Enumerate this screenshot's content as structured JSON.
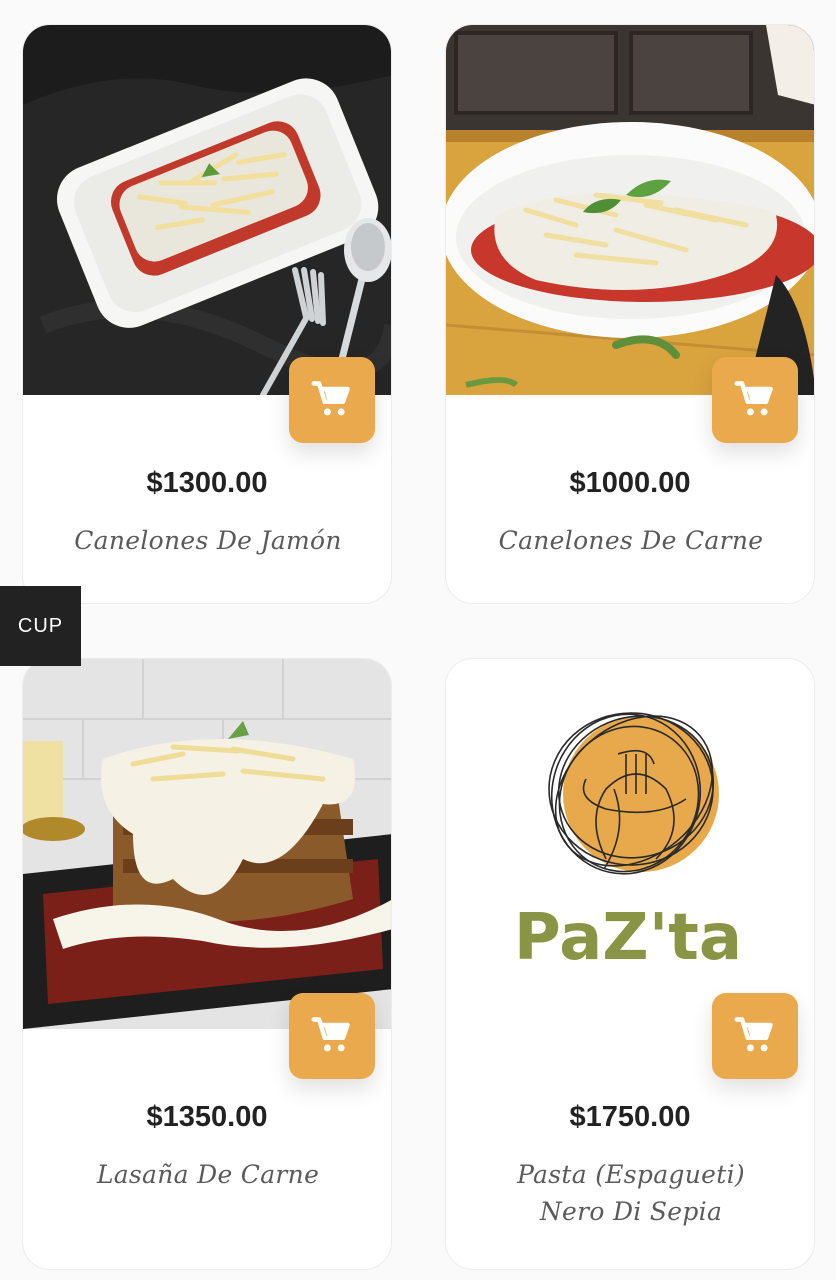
{
  "currency_tab": {
    "label": "CUP"
  },
  "colors": {
    "accent": "#e9a94c",
    "text_dark": "#222222",
    "text_name": "#5a5a5a",
    "logo_green": "#8a9445"
  },
  "products": [
    {
      "price": "$1300.00",
      "name": "Canelones De Jamón",
      "image": "white plate of cannelloni with tomato sauce and cheese on dark cloth"
    },
    {
      "price": "$1000.00",
      "name": "Canelones De Carne",
      "image": "round white plate of meat cannelloni with basil on wooden table"
    },
    {
      "price": "$1350.00",
      "name": "Lasaña De Carne",
      "image": "lasagna with white sauce and cheese on dark tray"
    },
    {
      "price": "$1750.00",
      "name_line1": "Pasta (Espagueti)",
      "name_line2": "Nero Di Sepia",
      "image": "PaZta placeholder logo"
    }
  ],
  "logo": {
    "text": "PaZ'ta"
  },
  "icons": {
    "cart": "shopping-cart-icon"
  }
}
